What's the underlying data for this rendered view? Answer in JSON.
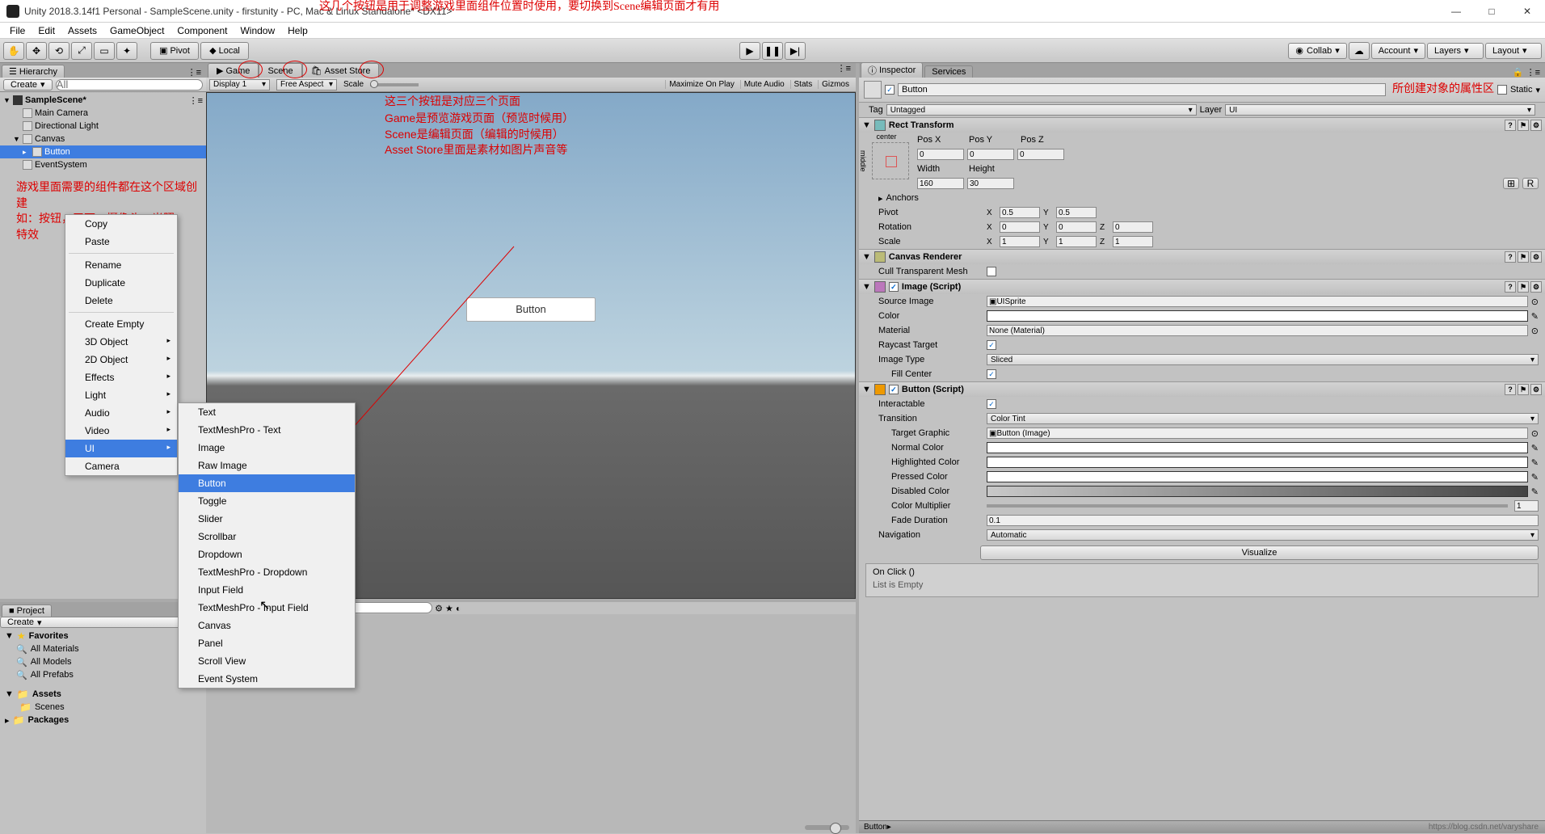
{
  "title": "Unity 2018.3.14f1 Personal - SampleScene.unity - firstunity - PC, Mac & Linux Standalone* <DX11>",
  "menubar": [
    "File",
    "Edit",
    "Assets",
    "GameObject",
    "Component",
    "Window",
    "Help"
  ],
  "toolbar": {
    "pivot": "Pivot",
    "local": "Local",
    "collab": "Collab",
    "account": "Account",
    "layers": "Layers",
    "layout": "Layout"
  },
  "hierarchy": {
    "tab": "Hierarchy",
    "create": "Create",
    "search_ph": "All",
    "scene": "SampleScene*",
    "items": [
      "Main Camera",
      "Directional Light",
      "Canvas",
      "Button",
      "EventSystem"
    ]
  },
  "annotations": {
    "top": "这几个按钮是用于调整游戏里面组件位置时使用，要切换到Scene编辑页面才有用",
    "tabs": "这三个按钮是对应三个页面",
    "desc1": "Game是预览游戏页面（预览时候用）",
    "desc2": "Scene是编辑页面（编辑的时候用）",
    "desc3": "Asset Store里面是素材如图片声音等",
    "hier1": "游戏里面需要的组件都在这个区域创建",
    "hier2": "如：按钮，平面，摄像头，光照",
    "hier3": "特效",
    "insp": "所创建对象的属性区"
  },
  "view": {
    "tabs": [
      "Game",
      "Scene",
      "Asset Store"
    ],
    "display": "Display 1",
    "aspect": "Free Aspect",
    "scale": "Scale",
    "right": [
      "Maximize On Play",
      "Mute Audio",
      "Stats",
      "Gizmos"
    ],
    "button_text": "Button"
  },
  "ctx_menu1": [
    "Copy",
    "Paste",
    "",
    "Rename",
    "Duplicate",
    "Delete",
    "",
    "Create Empty",
    "3D Object",
    "2D Object",
    "Effects",
    "Light",
    "Audio",
    "Video",
    "UI",
    "Camera"
  ],
  "ctx_menu2": [
    "Text",
    "TextMeshPro - Text",
    "Image",
    "Raw Image",
    "Button",
    "Toggle",
    "Slider",
    "Scrollbar",
    "Dropdown",
    "TextMeshPro - Dropdown",
    "Input Field",
    "TextMeshPro - Input Field",
    "Canvas",
    "Panel",
    "Scroll View",
    "Event System"
  ],
  "project": {
    "tab": "Project",
    "create": "Create",
    "favorites": "Favorites",
    "fav_items": [
      "All Materials",
      "All Models",
      "All Prefabs"
    ],
    "assets": "Assets",
    "asset_items": [
      "Scenes"
    ],
    "packages": "Packages"
  },
  "inspector": {
    "tab": "Inspector",
    "tab2": "Services",
    "name": "Button",
    "static": "Static",
    "tag_label": "Tag",
    "tag": "Untagged",
    "layer_label": "Layer",
    "layer": "UI",
    "rect": {
      "title": "Rect Transform",
      "anchor": "center",
      "middle": "middle",
      "posx": "Pos X",
      "posy": "Pos Y",
      "posz": "Pos Z",
      "x": "0",
      "y": "0",
      "z": "0",
      "width": "Width",
      "height": "Height",
      "w": "160",
      "h": "30",
      "anchors": "Anchors",
      "pivot": "Pivot",
      "px": "0.5",
      "py": "0.5",
      "rotation": "Rotation",
      "rx": "0",
      "ry": "0",
      "rz": "0",
      "scale": "Scale",
      "sx": "1",
      "sy": "1",
      "sz": "1"
    },
    "canvas_renderer": {
      "title": "Canvas Renderer",
      "cull": "Cull Transparent Mesh"
    },
    "image": {
      "title": "Image (Script)",
      "source": "Source Image",
      "source_v": "UISprite",
      "color": "Color",
      "material": "Material",
      "material_v": "None (Material)",
      "raycast": "Raycast Target",
      "type": "Image Type",
      "type_v": "Sliced",
      "fill": "Fill Center"
    },
    "button": {
      "title": "Button (Script)",
      "interactable": "Interactable",
      "transition": "Transition",
      "transition_v": "Color Tint",
      "target": "Target Graphic",
      "target_v": "Button (Image)",
      "normal": "Normal Color",
      "high": "Highlighted Color",
      "pressed": "Pressed Color",
      "disabled": "Disabled Color",
      "mult": "Color Multiplier",
      "mult_v": "1",
      "fade": "Fade Duration",
      "fade_v": "0.1",
      "nav": "Navigation",
      "nav_v": "Automatic",
      "vis": "Visualize",
      "onclick": "On Click ()",
      "empty": "List is Empty"
    },
    "status": "Button"
  },
  "footer": "https://blog.csdn.net/varyshare"
}
